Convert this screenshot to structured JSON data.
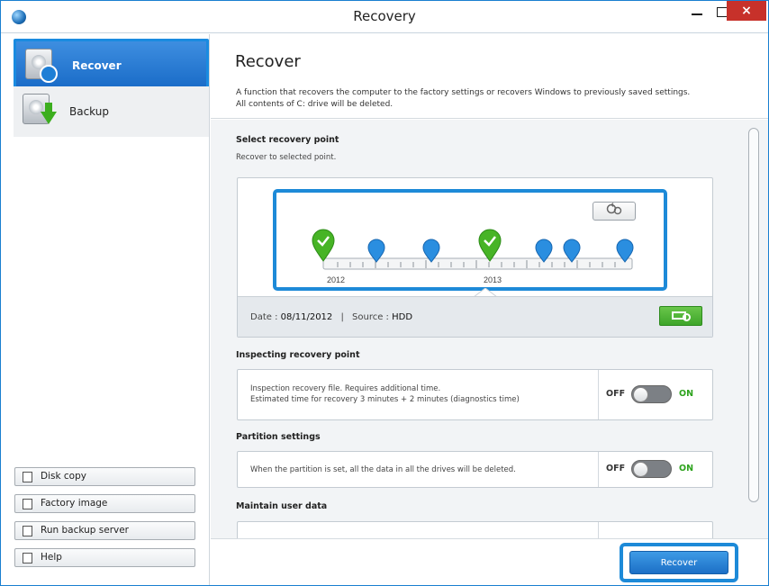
{
  "window": {
    "title": "Recovery",
    "close_glyph": "×",
    "colors": {
      "accent": "#1d8ad8",
      "close": "#c7312a",
      "on": "#2ea31e"
    }
  },
  "sidebar": {
    "nav": [
      {
        "label": "Recover",
        "icon": "recover-disk-icon",
        "selected": true
      },
      {
        "label": "Backup",
        "icon": "backup-disk-icon",
        "selected": false
      }
    ],
    "buttons": [
      {
        "label": "Disk copy",
        "icon": "disk-copy-icon"
      },
      {
        "label": "Factory image",
        "icon": "factory-image-icon"
      },
      {
        "label": "Run backup server",
        "icon": "backup-server-icon"
      },
      {
        "label": "Help",
        "icon": "help-icon"
      }
    ]
  },
  "main": {
    "title": "Recover",
    "description_line1": "A function that recovers the computer to the factory settings or recovers Windows to previously saved settings.",
    "description_line2": "All contents of C: drive will be deleted.",
    "recovery_point": {
      "title": "Select recovery point",
      "subtitle": "Recover to selected point.",
      "years": [
        "2012",
        "2013"
      ],
      "date_label": "Date :",
      "date_value": "08/11/2012",
      "separator": "|",
      "source_label": "Source :",
      "source_value": "HDD"
    },
    "inspecting": {
      "title": "Inspecting recovery point",
      "line1": "Inspection recovery file. Requires additional time.",
      "line2": "Estimated time for recovery 3 minutes + 2 minutes (diagnostics time)",
      "off": "OFF",
      "on": "ON"
    },
    "partition": {
      "title": "Partition settings",
      "text": "When the partition is set, all the data in all the drives will be deleted.",
      "off": "OFF",
      "on": "ON"
    },
    "maintain": {
      "title": "Maintain user data"
    },
    "recover_button": "Recover"
  }
}
